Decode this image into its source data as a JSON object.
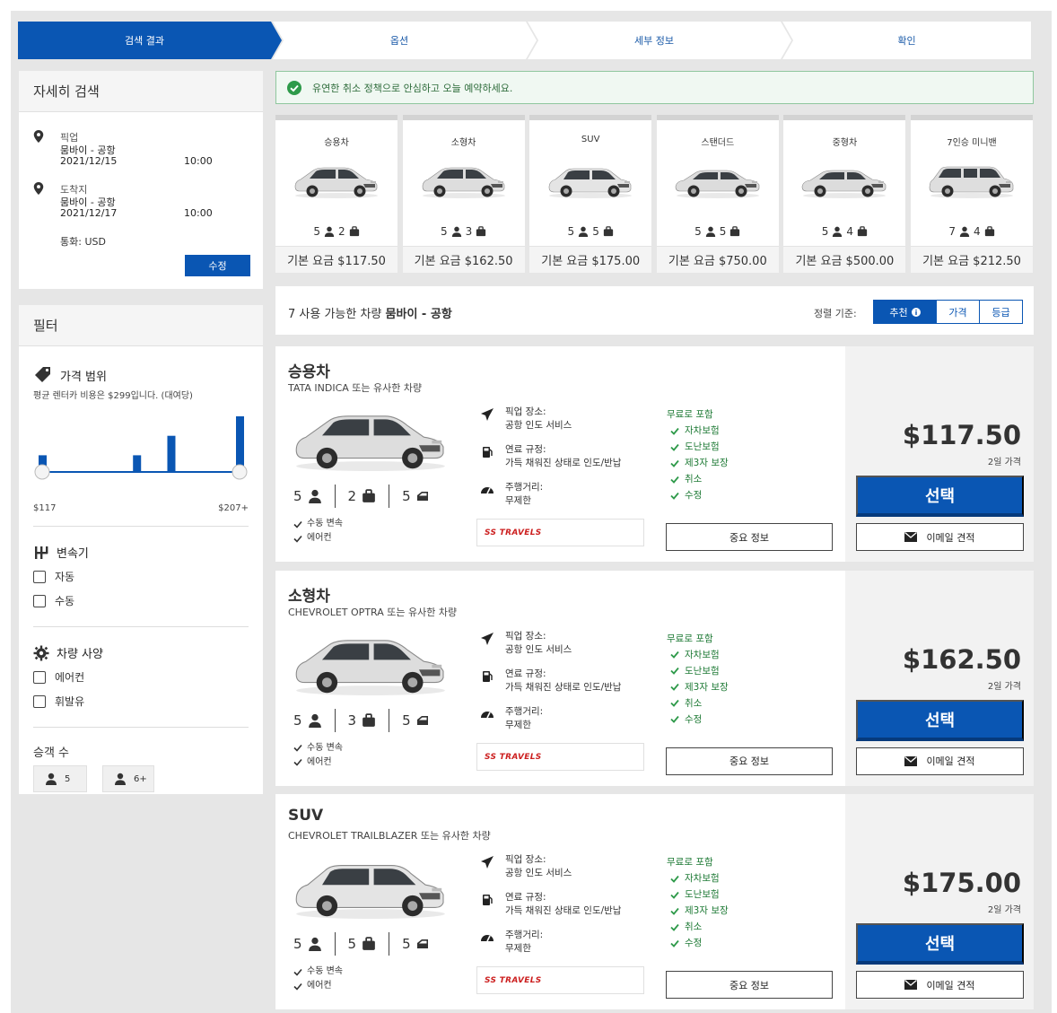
{
  "steps": [
    "검색 결과",
    "옵션",
    "세부 정보",
    "확인"
  ],
  "search": {
    "title": "자세히 검색",
    "pickup_label": "픽업",
    "pickup_place": "뭄바이 - 공항",
    "pickup_date": "2021/12/15",
    "pickup_time": "10:00",
    "dropoff_label": "도착지",
    "dropoff_place": "뭄바이 - 공항",
    "dropoff_date": "2021/12/17",
    "dropoff_time": "10:00",
    "currency": "통화: USD",
    "edit_label": "수정"
  },
  "filter": {
    "title": "필터",
    "price_title": "가격 범위",
    "price_note": "평균 렌터카 비용은 $299입니다. (대여당)",
    "price_min": "$117",
    "price_max": "$207+",
    "histogram": [
      0.3,
      0.0,
      0.0,
      0.0,
      0.0,
      0.0,
      0.0,
      0.0,
      0.0,
      0.0,
      0.0,
      0.3,
      0.0,
      0.0,
      0.0,
      0.65,
      0.0,
      0.0,
      0.0,
      0.0,
      0.0,
      0.0,
      0.0,
      1.0
    ],
    "transmission_title": "변속기",
    "transmission_options": [
      "자동",
      "수동"
    ],
    "features_title": "차량 사양",
    "features_options": [
      "에어컨",
      "휘발유"
    ],
    "pax_title": "승객 수",
    "pax_options": [
      "5",
      "6+"
    ]
  },
  "banner": "유연한 취소 정책으로 안심하고 오늘 예약하세요.",
  "categories": [
    {
      "name": "승용차",
      "pax": "5",
      "bags": "2",
      "price": "기본 요금 $117.50"
    },
    {
      "name": "소형차",
      "pax": "5",
      "bags": "3",
      "price": "기본 요금 $162.50"
    },
    {
      "name": "SUV",
      "pax": "5",
      "bags": "5",
      "price": "기본 요금 $175.00"
    },
    {
      "name": "스탠더드",
      "pax": "5",
      "bags": "5",
      "price": "기본 요금 $750.00"
    },
    {
      "name": "중형차",
      "pax": "5",
      "bags": "4",
      "price": "기본 요금 $500.00"
    },
    {
      "name": "7인승 미니밴",
      "pax": "7",
      "bags": "4",
      "price": "기본 요금 $212.50"
    }
  ],
  "sortbar": {
    "count_prefix": "7 사용 가능한 차량",
    "location": "뭄바이 - 공항",
    "label": "정렬 기준:",
    "options": [
      "추천",
      "가격",
      "등급"
    ]
  },
  "cards": [
    {
      "title": "승용차",
      "model": "TATA INDICA 또는 유사한 차량",
      "pax": "5",
      "bags": "2",
      "doors": "5",
      "features": [
        "수동 변속",
        "에어컨"
      ],
      "pickup_label": "픽업 장소:",
      "pickup_value": "공항 인도 서비스",
      "fuel_label": "연료 규정:",
      "fuel_value": "가득 채워진 상태로 인도/반납",
      "mileage_label": "주행거리:",
      "mileage_value": "무제한",
      "vendor": "SS TRAVELS",
      "included_title": "무료로 포함",
      "included": [
        "자차보험",
        "도난보험",
        "제3자 보장",
        "취소",
        "수정"
      ],
      "info_label": "중요 정보",
      "price": "$117.50",
      "price_note": "2일 가격",
      "select_label": "선택",
      "email_label": "이메일 견적"
    },
    {
      "title": "소형차",
      "model": "CHEVROLET OPTRA 또는 유사한 차량",
      "pax": "5",
      "bags": "3",
      "doors": "5",
      "features": [
        "수동 변속",
        "에어컨"
      ],
      "pickup_label": "픽업 장소:",
      "pickup_value": "공항 인도 서비스",
      "fuel_label": "연료 규정:",
      "fuel_value": "가득 채워진 상태로 인도/반납",
      "mileage_label": "주행거리:",
      "mileage_value": "무제한",
      "vendor": "SS TRAVELS",
      "included_title": "무료로 포함",
      "included": [
        "자차보험",
        "도난보험",
        "제3자 보장",
        "취소",
        "수정"
      ],
      "info_label": "중요 정보",
      "price": "$162.50",
      "price_note": "2일 가격",
      "select_label": "선택",
      "email_label": "이메일 견적"
    },
    {
      "title": "SUV",
      "model": "CHEVROLET TRAILBLAZER 또는 유사한 차량",
      "pax": "5",
      "bags": "5",
      "doors": "5",
      "features": [
        "수동 변속",
        "에어컨"
      ],
      "pickup_label": "픽업 장소:",
      "pickup_value": "공항 인도 서비스",
      "fuel_label": "연료 규정:",
      "fuel_value": "가득 채워진 상태로 인도/반납",
      "mileage_label": "주행거리:",
      "mileage_value": "무제한",
      "vendor": "SS TRAVELS",
      "included_title": "무료로 포함",
      "included": [
        "자차보험",
        "도난보험",
        "제3자 보장",
        "취소",
        "수정"
      ],
      "info_label": "중요 정보",
      "price": "$175.00",
      "price_note": "2일 가격",
      "select_label": "선택",
      "email_label": "이메일 견적"
    }
  ]
}
